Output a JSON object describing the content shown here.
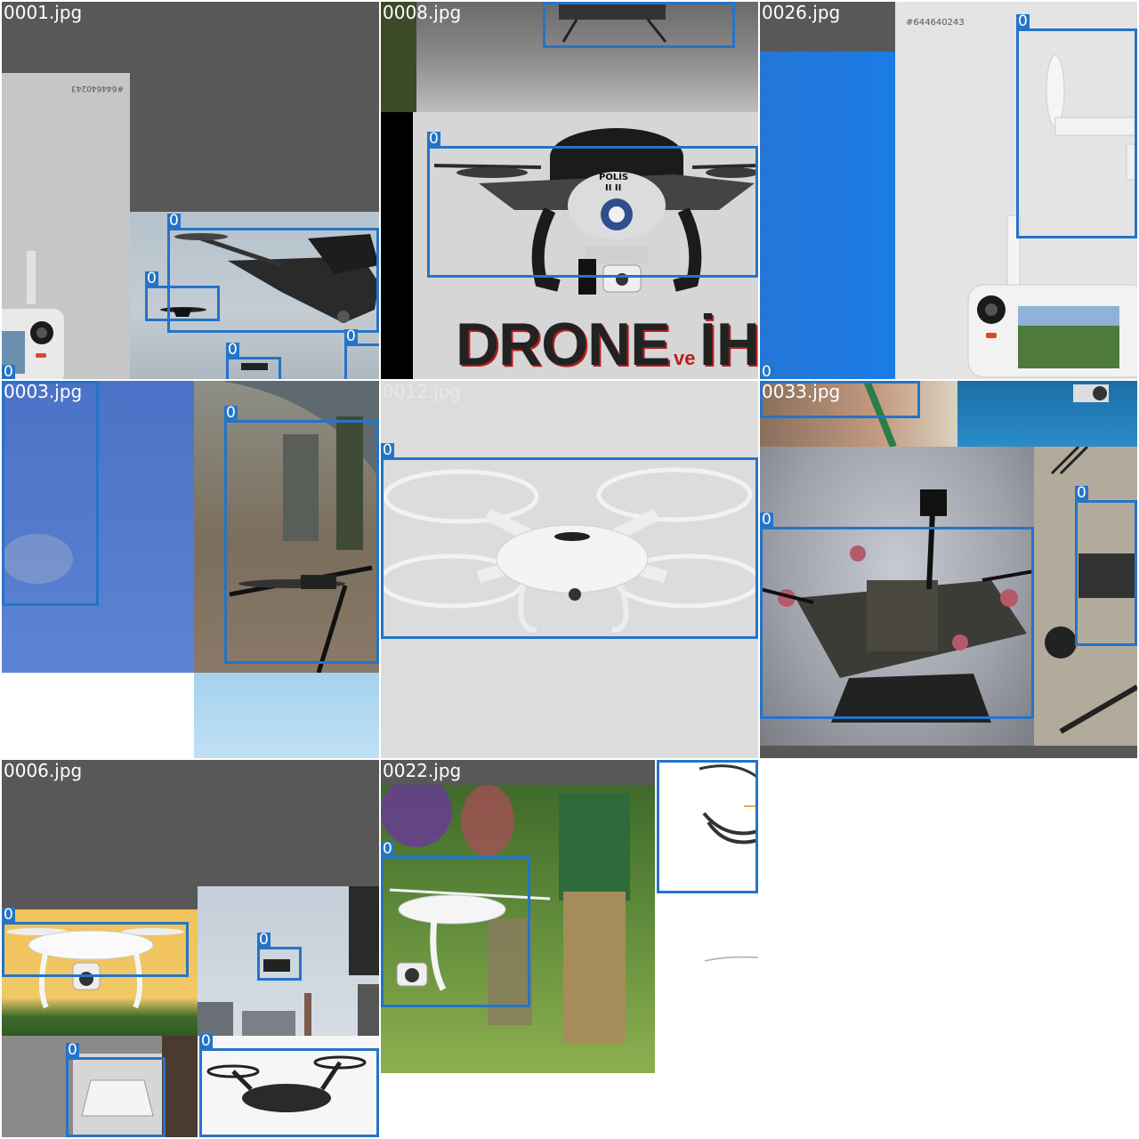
{
  "grid": {
    "tiles": [
      {
        "filename": "0001.jpg"
      },
      {
        "filename": "0008.jpg"
      },
      {
        "filename": "0026.jpg"
      },
      {
        "filename": "0003.jpg"
      },
      {
        "filename": "0012.jpg"
      },
      {
        "filename": "0033.jpg"
      },
      {
        "filename": "0006.jpg"
      },
      {
        "filename": "0022.jpg"
      }
    ]
  },
  "box_label": "0",
  "photo_text": {
    "serial": "#644640243",
    "serial_mirrored": "#644640243",
    "police": "POLİS",
    "police_sub": "II II",
    "headline_main": "DRONE",
    "headline_ve": "ve",
    "headline_tail": "İHA"
  },
  "colors": {
    "box": "#2474c7",
    "tile_bg_gray": "#595959",
    "filename_text": "#ffffff"
  },
  "icons": [
    "drone-icon",
    "remote-controller-icon"
  ]
}
